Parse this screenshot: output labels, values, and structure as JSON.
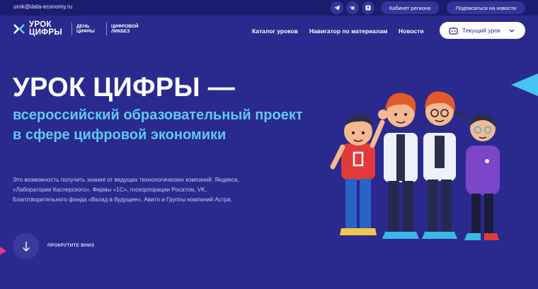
{
  "topbar": {
    "email": "urok@data-economy.ru",
    "social": [
      "telegram-icon",
      "vk-icon",
      "odnoklassniki-icon"
    ],
    "cabinet": "Кабинет региона",
    "subscribe": "Подписаться на новости"
  },
  "header": {
    "logo_main": "УРОК\nЦИФРЫ",
    "logo_sub_1": "ДЕНЬ\nЦИФРЫ",
    "logo_sub_2": "ЦИФРОВОЙ\nЛИКБЕЗ",
    "nav": [
      "Каталог уроков",
      "Навигатор по материалам",
      "Новости"
    ],
    "current_lesson": "Текущий урок"
  },
  "hero": {
    "title": "УРОК ЦИФРЫ —",
    "subtitle": "всероссийский образовательный проект в сфере цифровой экономики",
    "description": "Это возможность получить знания от ведущих технологических компаний: Яндекса, «Лаборатории Касперского», Фирмы «1С», госкорпорации Росатом, VK, Благотворительного фонда «Вклад в будущее», Авито и Группы компаний Астра.",
    "scroll_label": "ПРОКРУТИТЕ ВНИЗ"
  },
  "colors": {
    "background": "#2a2a8e",
    "topbar": "#1c1c6e",
    "accent_blue": "#5ec8f6",
    "accent_pink": "#e6338b"
  }
}
